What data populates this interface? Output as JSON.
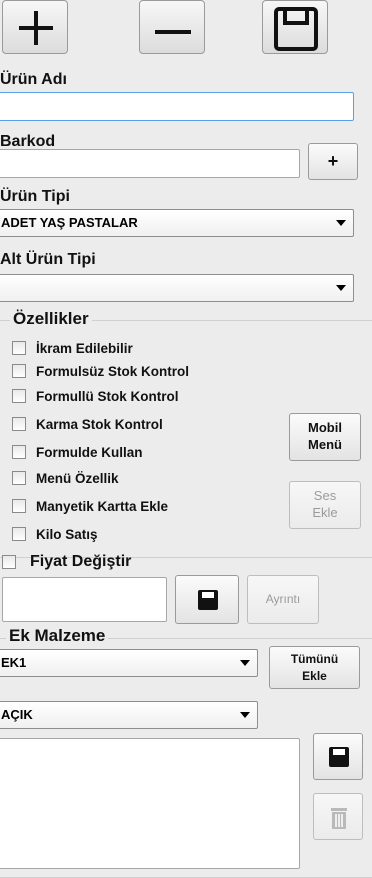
{
  "toolbar": {
    "add_icon": "plus-icon",
    "remove_icon": "minus-icon",
    "save_icon": "floppy-disk-icon"
  },
  "product_name": {
    "label": "Ürün Adı",
    "value": ""
  },
  "barcode": {
    "label": "Barkod",
    "value": "",
    "add_button_label": "+"
  },
  "product_type": {
    "label": "Ürün Tipi",
    "selected": "ADET YAŞ PASTALAR"
  },
  "sub_product_type": {
    "label": "Alt Ürün Tipi",
    "selected": ""
  },
  "features": {
    "title": "Özellikler",
    "items": [
      {
        "label": "İkram Edilebilir",
        "checked": false
      },
      {
        "label": "Formulsüz Stok Kontrol",
        "checked": false
      },
      {
        "label": "Formullü Stok Kontrol",
        "checked": false
      },
      {
        "label": "Karma Stok Kontrol",
        "checked": false
      },
      {
        "label": "Formulde Kullan",
        "checked": false
      },
      {
        "label": "Menü Özellik",
        "checked": false
      },
      {
        "label": "Manyetik Kartta Ekle",
        "checked": false
      },
      {
        "label": "Kilo Satış",
        "checked": false
      }
    ],
    "mobile_menu_button": {
      "line1": "Mobil",
      "line2": "Menü"
    },
    "add_sound_button": {
      "line1": "Ses",
      "line2": "Ekle"
    }
  },
  "price": {
    "change_label": "Fiyat Değiştir",
    "checked": false,
    "value": "",
    "save_icon": "floppy-disk-icon",
    "details_button": "Ayrıntı"
  },
  "extra_material": {
    "title": "Ek Malzeme",
    "select1": "EK1",
    "select2": "AÇIK",
    "add_all_button": {
      "line1": "Tümünü",
      "line2": "Ekle"
    },
    "save_icon": "floppy-disk-icon",
    "delete_icon": "trash-icon"
  },
  "colors": {
    "background": "#ececec",
    "focus_border": "#5aa0e6"
  }
}
